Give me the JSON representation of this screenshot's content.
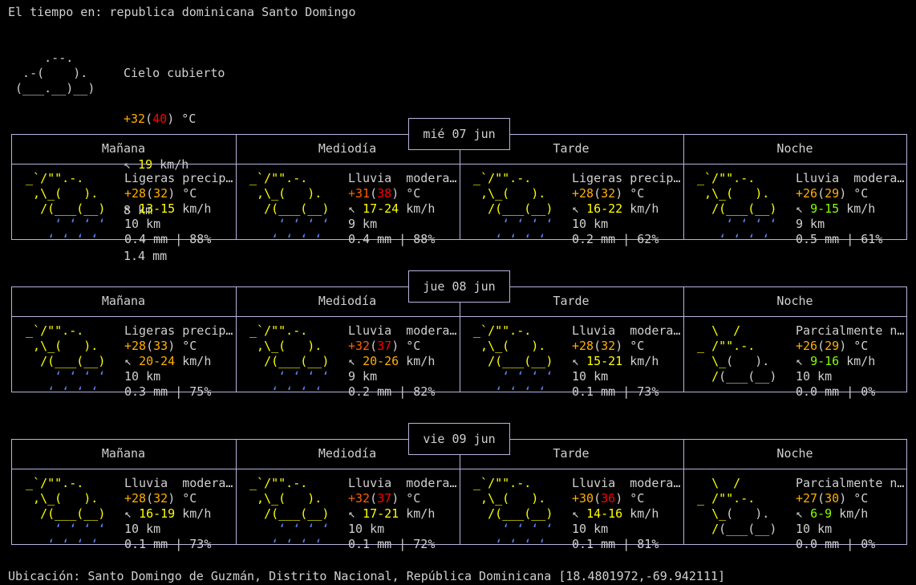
{
  "title": "El tiempo en: republica dominicana Santo Domingo",
  "current": {
    "condition": "Cielo cubierto",
    "temp": "+32",
    "feels": "40",
    "temp_unit": "°C",
    "wind_arrow": "↖",
    "wind": "19",
    "wind_unit": "km/h",
    "visibility": "8 km",
    "precip": "1.4 mm",
    "art": [
      "",
      "     .--.    ",
      "  .-(    ).  ",
      " (___.__)__) "
    ]
  },
  "periods": [
    "Mañana",
    "Mediodía",
    "Tarde",
    "Noche"
  ],
  "days": [
    {
      "date": "mié 07 jun",
      "cells": [
        {
          "icon": "rain-icon",
          "cond": "Ligeras precip…",
          "temp": "+28",
          "feels": "32",
          "wind": "13-15",
          "vis": "10 km",
          "precip": "0.4 mm | 88%"
        },
        {
          "icon": "rain-icon",
          "cond": "Lluvia  modera…",
          "temp": "+31",
          "feels": "38",
          "wind": "17-24",
          "vis": "9 km",
          "precip": "0.4 mm | 88%"
        },
        {
          "icon": "rain-icon",
          "cond": "Ligeras precip…",
          "temp": "+28",
          "feels": "32",
          "wind": "16-22",
          "vis": "10 km",
          "precip": "0.2 mm | 62%"
        },
        {
          "icon": "rain-icon",
          "cond": "Lluvia  modera…",
          "temp": "+26",
          "feels": "29",
          "wind": "9-15",
          "vis": "9 km",
          "precip": "0.5 mm | 61%"
        }
      ]
    },
    {
      "date": "jue 08 jun",
      "cells": [
        {
          "icon": "rain-icon",
          "cond": "Ligeras precip…",
          "temp": "+28",
          "feels": "33",
          "wind": "20-24",
          "vis": "10 km",
          "precip": "0.3 mm | 75%"
        },
        {
          "icon": "rain-icon",
          "cond": "Lluvia  modera…",
          "temp": "+32",
          "feels": "37",
          "wind": "20-26",
          "vis": "9 km",
          "precip": "0.2 mm | 82%"
        },
        {
          "icon": "rain-icon",
          "cond": "Lluvia  modera…",
          "temp": "+28",
          "feels": "32",
          "wind": "15-21",
          "vis": "10 km",
          "precip": "0.1 mm | 73%"
        },
        {
          "icon": "partly-cloudy-icon",
          "cond": "Parcialmente n…",
          "temp": "+26",
          "feels": "29",
          "wind": "9-16",
          "vis": "10 km",
          "precip": "0.0 mm | 0%"
        }
      ]
    },
    {
      "date": "vie 09 jun",
      "cells": [
        {
          "icon": "rain-icon",
          "cond": "Lluvia  modera…",
          "temp": "+28",
          "feels": "32",
          "wind": "16-19",
          "vis": "10 km",
          "precip": "0.1 mm | 73%"
        },
        {
          "icon": "rain-icon",
          "cond": "Lluvia  modera…",
          "temp": "+32",
          "feels": "37",
          "wind": "17-21",
          "vis": "10 km",
          "precip": "0.1 mm | 72%"
        },
        {
          "icon": "rain-icon",
          "cond": "Lluvia  modera…",
          "temp": "+30",
          "feels": "36",
          "wind": "14-16",
          "vis": "10 km",
          "precip": "0.1 mm | 81%"
        },
        {
          "icon": "partly-cloudy-icon",
          "cond": "Parcialmente n…",
          "temp": "+27",
          "feels": "30",
          "wind": "6-9",
          "vis": "10 km",
          "precip": "0.0 mm | 0%"
        }
      ]
    }
  ],
  "footer": "Ubicación: Santo Domingo de Guzmán, Distrito Nacional, República Dominicana [18.4801972,-69.942111]"
}
